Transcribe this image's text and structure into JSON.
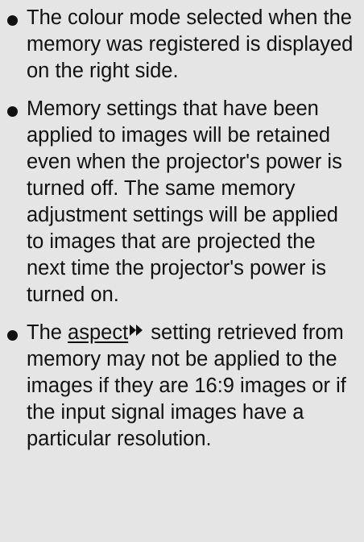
{
  "notes": [
    {
      "text": "The colour mode selected when the memory was registered is displayed on the right side."
    },
    {
      "text": "Memory settings that have been applied to images will be retained even when the projector's power is turned off. The same memory adjustment settings will be applied to images that are projected the next time the projector's power is turned on."
    },
    {
      "before": "The ",
      "link": "aspect",
      "after": " setting retrieved from memory may not be applied to the images if they are 16:9 images or if the input signal images have a particular resolution."
    }
  ],
  "icons": {
    "bullet": "bullet-icon",
    "reference": "double-arrow-right-icon"
  }
}
